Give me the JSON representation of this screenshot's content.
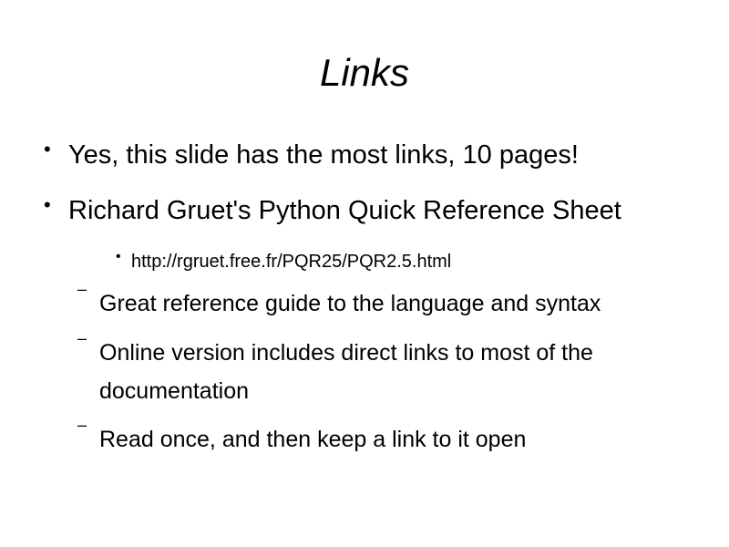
{
  "slide": {
    "title": "Links",
    "bullet_glyph": "•",
    "dash_glyph": "–",
    "items": [
      {
        "text": "Yes, this slide has the most links, 10 pages!"
      },
      {
        "text": "Richard Gruet's Python Quick Reference Sheet"
      }
    ],
    "subitems": [
      {
        "text": "http://rgruet.free.fr/PQR25/PQR2.5.html"
      }
    ],
    "dashes": [
      {
        "text": "Great reference guide to the language and syntax"
      },
      {
        "text": "Online version includes direct links to most of the documentation"
      },
      {
        "text": "Read once, and then keep a link to it open"
      }
    ]
  }
}
